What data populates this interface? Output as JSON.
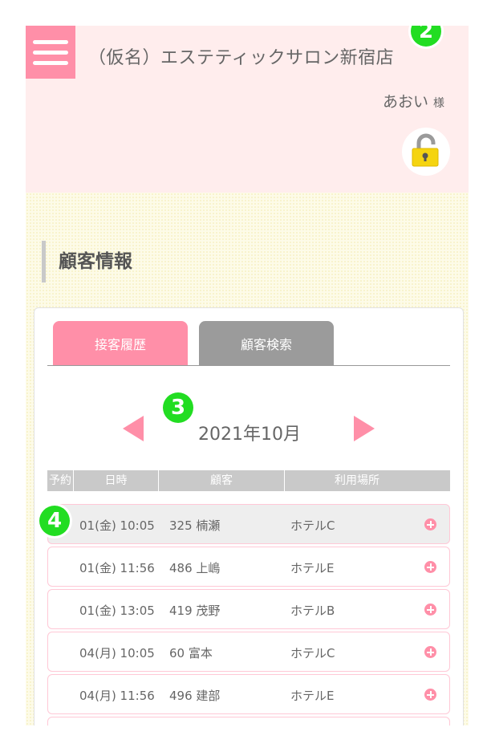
{
  "header": {
    "shop_name": "（仮名）エステティックサロン新宿店",
    "user_name": "あおい",
    "user_suffix": "様",
    "menu_icon": "hamburger-menu-icon",
    "lock_icon": "padlock-icon"
  },
  "markers": {
    "m2": "2",
    "m3": "3",
    "m4": "4"
  },
  "section": {
    "title": "顧客情報"
  },
  "tabs": [
    {
      "label": "接客履歴",
      "active": true
    },
    {
      "label": "顧客検索",
      "active": false
    }
  ],
  "calendar": {
    "month_label": "2021年10月"
  },
  "table": {
    "headers": [
      "予約",
      "日時",
      "顧客",
      "利用場所"
    ],
    "rows": [
      {
        "datetime": "01(金) 10:05",
        "customer": "325 楠瀬",
        "place": "ホテルC"
      },
      {
        "datetime": "01(金) 11:56",
        "customer": "486 上嶋",
        "place": "ホテルE"
      },
      {
        "datetime": "01(金) 13:05",
        "customer": "419 茂野",
        "place": "ホテルB"
      },
      {
        "datetime": "04(月) 10:05",
        "customer": "60 富本",
        "place": "ホテルC"
      },
      {
        "datetime": "04(月) 11:56",
        "customer": "496 建部",
        "place": "ホテルE"
      }
    ]
  },
  "colors": {
    "accent_pink": "#ff8fa8",
    "header_bg": "#ffeded",
    "marker_green": "#22dd22",
    "tab_gray": "#9b9b9b"
  }
}
